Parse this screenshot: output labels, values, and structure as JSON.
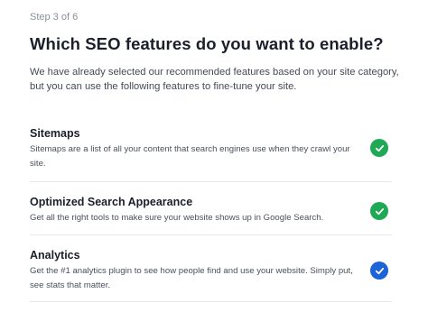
{
  "step_label": "Step 3 of 6",
  "heading": "Which SEO features do you want to enable?",
  "intro": "We have already selected our recommended features based on your site category, but you can use the following features to fine-tune your site.",
  "colors": {
    "green": "#1fa855",
    "blue": "#1d63d8"
  },
  "features": [
    {
      "title": "Sitemaps",
      "description": "Sitemaps are a list of all your content that search engines use when they crawl your site.",
      "enabled": true,
      "icon": "check-icon",
      "color": "green"
    },
    {
      "title": "Optimized Search Appearance",
      "description": "Get all the right tools to make sure your website shows up in Google Search.",
      "enabled": true,
      "icon": "check-icon",
      "color": "green"
    },
    {
      "title": "Analytics",
      "description": "Get the #1 analytics plugin to see how people find and use your website. Simply put, see stats that matter.",
      "enabled": true,
      "icon": "check-icon",
      "color": "blue"
    }
  ]
}
